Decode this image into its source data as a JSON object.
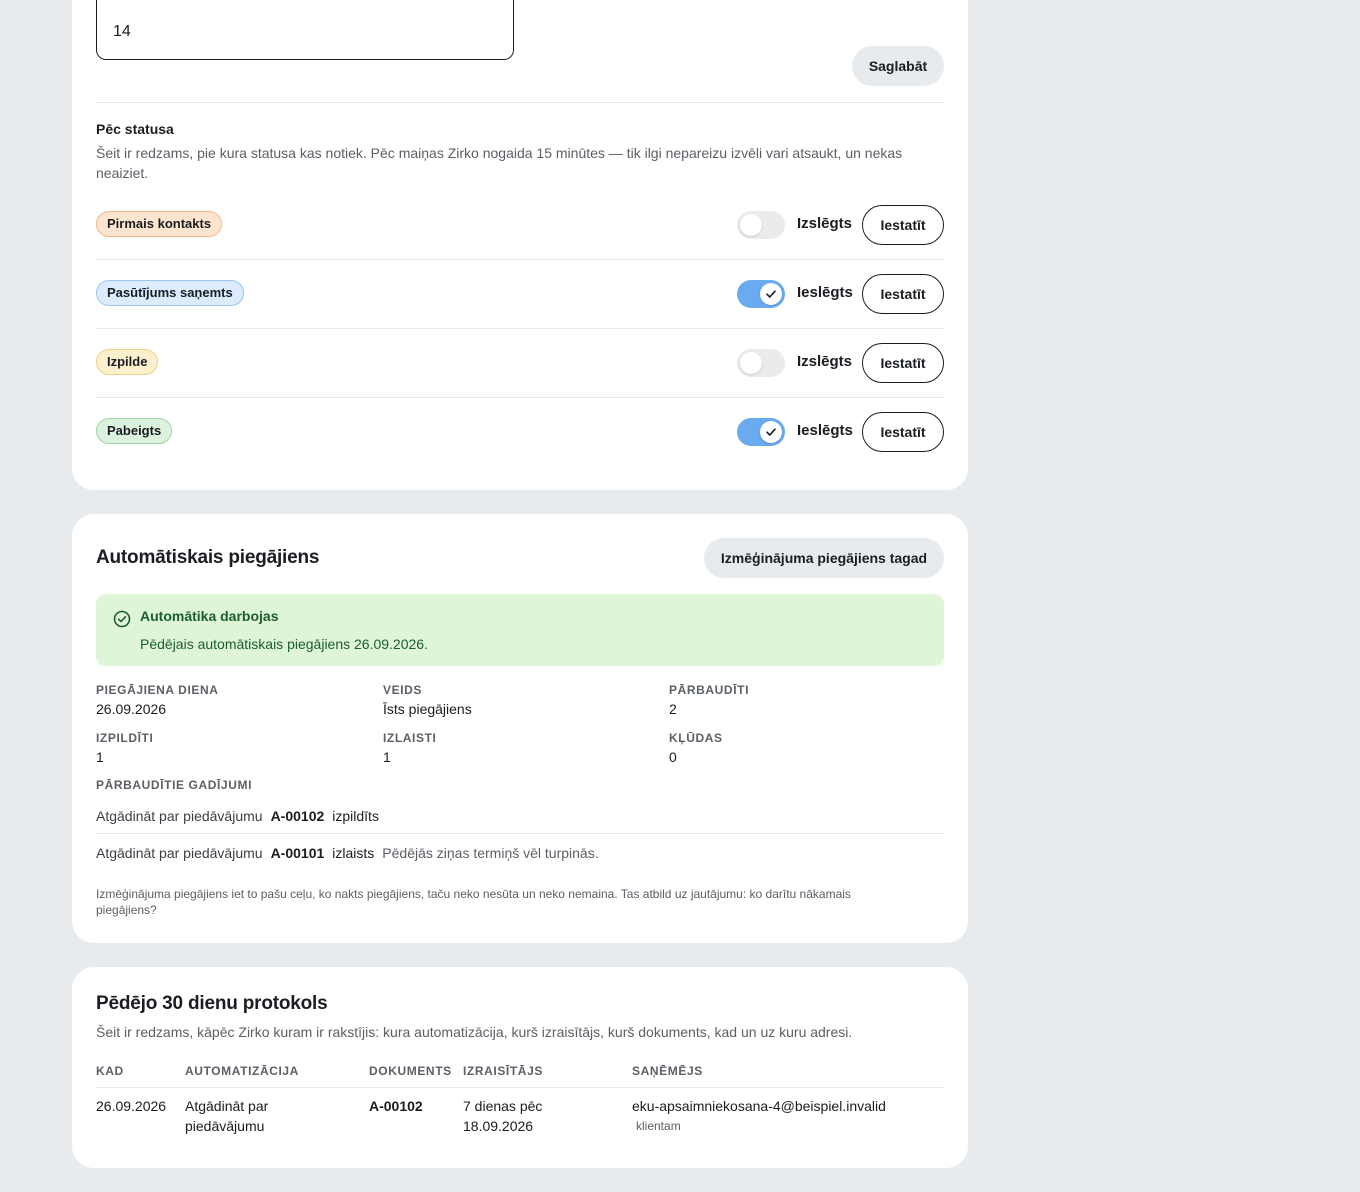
{
  "reminder_settings": {
    "days_value": "14",
    "save_label": "Saglabāt"
  },
  "by_status": {
    "title": "Pēc statusa",
    "description": "Šeit ir redzams, pie kura statusa kas notiek. Pēc maiņas Zirko nogaida 15 minūtes — tik ilgi nepareizu izvēli vari atsaukt, un nekas neaiziet.",
    "configure_label": "Iestatīt",
    "rows": [
      {
        "badge": "Pirmais kontakts",
        "state_label": "Izslēgts",
        "enabled": false,
        "badge_bg": "#fde4cf",
        "badge_border": "#f0b98c"
      },
      {
        "badge": "Pasūtījums saņemts",
        "state_label": "Ieslēgts",
        "enabled": true,
        "badge_bg": "#dcebfd",
        "badge_border": "#9cc5f2"
      },
      {
        "badge": "Izpilde",
        "state_label": "Izslēgts",
        "enabled": false,
        "badge_bg": "#fdf0cc",
        "badge_border": "#ecd187"
      },
      {
        "badge": "Pabeigts",
        "state_label": "Ieslēgts",
        "enabled": true,
        "badge_bg": "#dcf2de",
        "badge_border": "#9fd3a6"
      }
    ]
  },
  "auto_run": {
    "title": "Automātiskais piegājiens",
    "trial_button": "Izmēģinājuma piegājiens tagad",
    "status_title": "Automātika darbojas",
    "status_text": "Pēdējais automātiskais piegājiens 26.09.2026.",
    "stats": [
      {
        "label": "PIEGĀJIENA DIENA",
        "value": "26.09.2026"
      },
      {
        "label": "VEIDS",
        "value": "Īsts piegājiens"
      },
      {
        "label": "PĀRBAUDĪTI",
        "value": "2"
      },
      {
        "label": "IZPILDĪTI",
        "value": "1"
      },
      {
        "label": "IZLAISTI",
        "value": "1"
      },
      {
        "label": "KĻŪDAS",
        "value": "0"
      }
    ],
    "checked_cases_label": "PĀRBAUDĪTIE GADĪJUMI",
    "cases": [
      {
        "action": "Atgādināt par piedāvājumu",
        "code": "A-00102",
        "status": "izpildīts",
        "note": ""
      },
      {
        "action": "Atgādināt par piedāvājumu",
        "code": "A-00101",
        "status": "izlaists",
        "note": "Pēdējās ziņas termiņš vēl turpinās."
      }
    ],
    "footnote": "Izmēģinājuma piegājiens iet to pašu ceļu, ko nakts piegājiens, taču neko nesūta un neko nemaina. Tas atbild uz jautājumu: ko darītu nākamais piegājiens?"
  },
  "log": {
    "title": "Pēdējo 30 dienu protokols",
    "description": "Šeit ir redzams, kāpēc Zirko kuram ir rakstījis: kura automatizācija, kurš izraisītājs, kurš dokuments, kad un uz kuru adresi.",
    "columns": [
      "KAD",
      "AUTOMATIZĀCIJA",
      "DOKUMENTS",
      "IZRAISĪTĀJS",
      "SAŅĒMĒJS"
    ],
    "rows": [
      {
        "when": "26.09.2026",
        "automation": "Atgādināt par piedāvājumu",
        "document": "A-00102",
        "trigger": "7 dienas pēc 18.09.2026",
        "recipient": "eku-apsaimniekosana-4@beispiel.invalid",
        "recipient_type": "klientam"
      }
    ]
  },
  "colors": {
    "background": "#e8ebee",
    "toggle_on": "#6aaaf0",
    "success_bg": "#dff5d8",
    "success_text": "#1b5e2a"
  }
}
